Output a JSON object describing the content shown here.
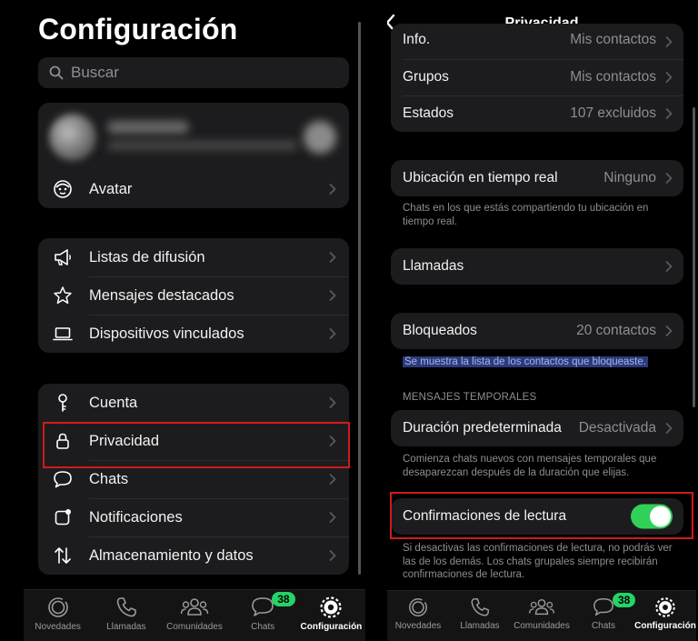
{
  "left": {
    "title": "Configuración",
    "search": {
      "placeholder": "Buscar"
    },
    "avatar_row": {
      "label": "Avatar",
      "icon": "avatar-icon"
    },
    "group2": [
      {
        "label": "Listas de difusión",
        "icon": "megaphone-icon"
      },
      {
        "label": "Mensajes destacados",
        "icon": "star-icon"
      },
      {
        "label": "Dispositivos vinculados",
        "icon": "laptop-icon"
      }
    ],
    "group3": [
      {
        "label": "Cuenta",
        "icon": "key-icon"
      },
      {
        "label": "Privacidad",
        "icon": "lock-icon"
      },
      {
        "label": "Chats",
        "icon": "chat-bubble-icon"
      },
      {
        "label": "Notificaciones",
        "icon": "notification-icon"
      },
      {
        "label": "Almacenamiento y datos",
        "icon": "arrows-updown-icon"
      }
    ],
    "tabs": [
      {
        "label": "Novedades",
        "icon": "status-icon"
      },
      {
        "label": "Llamadas",
        "icon": "phone-icon"
      },
      {
        "label": "Comunidades",
        "icon": "community-icon"
      },
      {
        "label": "Chats",
        "icon": "chats-icon",
        "badge": "38"
      },
      {
        "label": "Configuración",
        "icon": "settings-icon",
        "active": true
      }
    ]
  },
  "right": {
    "title": "Privacidad",
    "top_group": [
      {
        "label": "Info.",
        "value": "Mis contactos"
      },
      {
        "label": "Grupos",
        "value": "Mis contactos"
      },
      {
        "label": "Estados",
        "value": "107 excluidos"
      }
    ],
    "location": {
      "label": "Ubicación en tiempo real",
      "value": "Ninguno"
    },
    "location_note": "Chats en los que estás compartiendo tu ubicación en tiempo real.",
    "calls": {
      "label": "Llamadas"
    },
    "blocked": {
      "label": "Bloqueados",
      "value": "20 contactos"
    },
    "blocked_note": "Se muestra la lista de los contactos que bloqueaste.",
    "temp_section": "MENSAJES TEMPORALES",
    "default_duration": {
      "label": "Duración predeterminada",
      "value": "Desactivada"
    },
    "duration_note": "Comienza chats nuevos con mensajes temporales que desaparezcan después de la duración que elijas.",
    "read_receipts": {
      "label": "Confirmaciones de lectura",
      "enabled": true
    },
    "read_note": "Si desactivas las confirmaciones de lectura, no podrás ver las de los demás. Los chats grupales siempre recibirán confirmaciones de lectura.",
    "tabs": [
      {
        "label": "Novedades",
        "icon": "status-icon"
      },
      {
        "label": "Llamadas",
        "icon": "phone-icon"
      },
      {
        "label": "Comunidades",
        "icon": "community-icon"
      },
      {
        "label": "Chats",
        "icon": "chats-icon",
        "badge": "38"
      },
      {
        "label": "Configuración",
        "icon": "settings-icon",
        "active": true
      }
    ]
  },
  "colors": {
    "accent_green": "#25d366",
    "toggle_on": "#30d158",
    "highlight_red": "#d11a1a"
  }
}
